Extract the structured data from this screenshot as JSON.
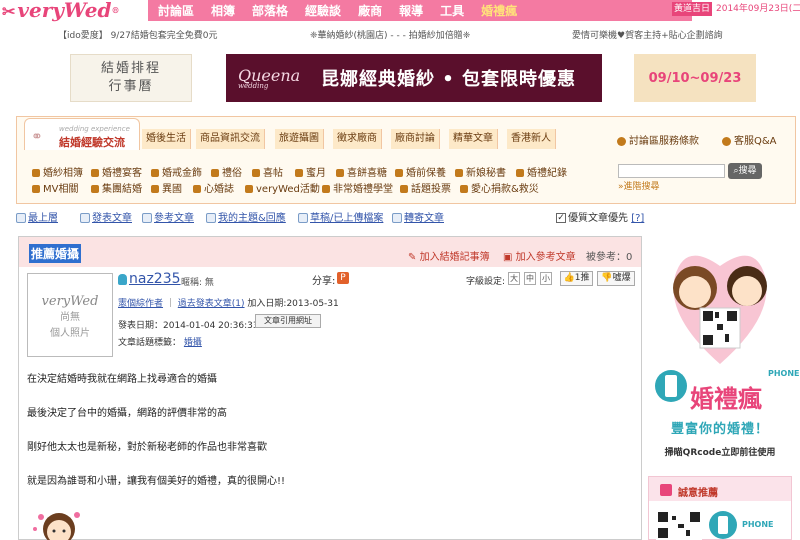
{
  "header": {
    "logo": "veryWed",
    "nav": [
      "討論區",
      "相簿",
      "部落格",
      "經驗談",
      "廠商",
      "報導",
      "工具",
      "婚禮瘋"
    ],
    "luck_badge": "黃道吉日",
    "date": "2014年09月23日(二)"
  },
  "ticker": [
    "【ido愛度】 9/27結婚包套完全免費0元",
    "❈華納婚紗(桃園店) - - - 拍婚紗加倍贈❈",
    "愛情可樂機♥賀客主持+貼心企劃諮詢"
  ],
  "banners": {
    "left": [
      "結婚排程",
      "行事曆"
    ],
    "center_brand": "Queena",
    "center_brand_sub": "wedding",
    "center_slogan": "昆娜經典婚紗 • 包套限時優惠",
    "right": "09/10~09/23"
  },
  "section": {
    "title_small": "wedding experience",
    "title": "結婚經驗交流",
    "tabs": [
      "婚後生活",
      "商品資訊交流",
      "旅遊攝圖",
      "徵求廠商",
      "廠商討論",
      "精華文章",
      "香港新人"
    ],
    "rules": "討論區服務條款",
    "faq": "客服Q&A",
    "sub_row1": [
      "婚紗相簿",
      "婚禮宴客",
      "婚戒金飾",
      "禮俗",
      "喜帖",
      "蜜月",
      "喜餅喜糖",
      "婚前保養",
      "新娘秘書",
      "婚禮紀錄"
    ],
    "sub_row2": [
      "MV相關",
      "集團結婚",
      "異國",
      "心婚誌",
      "veryWed活動",
      "非常婚禮學堂",
      "話題投票",
      "愛心捐款&救災"
    ],
    "search_button": "搜尋",
    "advanced_search": "»進階搜尋"
  },
  "toolbar": {
    "links": [
      "最上層",
      "發表文章",
      "參考文章",
      "我的主題&回應",
      "草稿/已上傳檔案",
      "轉寄文章"
    ],
    "priority_label": "優質文章優先",
    "priority_help": "[?]"
  },
  "post": {
    "title": "推薦婚攝",
    "add_note": "加入結婚記事簿",
    "add_ref": "加入參考文章",
    "ref_count": "被參考：0",
    "avatar_brand": "veryWed",
    "avatar_text": [
      "尚無",
      "個人照片"
    ],
    "username": "naz235",
    "nickname": "暱稱: 無",
    "share_label": "分享:",
    "share_icon": "P",
    "font_label": "字級設定:",
    "font_sizes": [
      "大",
      "中",
      "小"
    ],
    "like": "1推",
    "dislike": "噓爆",
    "user_link1": "憲個綜作者",
    "user_link2": "過去發表文章(1)",
    "join_date": "加入日期:2013-05-31",
    "publish_date": "發表日期：2014-01-04 20:36:33",
    "copy_url": "文章引用網址",
    "tag_label": "文章話題標籤：",
    "tag": "婚攝",
    "body": [
      "在決定結婚時我就在網路上找尋適合的婚攝",
      "最後決定了台中的婚攝，網路的評價非常的高",
      "剛好他太太也是新秘，對於新秘老師的作品也非常喜歡",
      "就是因為誰哥和小珊，讓我有個美好的婚禮，真的很開心!!"
    ]
  },
  "ad": {
    "phone_label": "PHONE",
    "brand": "婚禮瘋",
    "tagline": "豐富你的婚禮！",
    "scan": "掃瞄QRcode立即前往使用",
    "recommend": "誠意推薦",
    "rec_phone_label": "PHONE"
  },
  "colors": {
    "pink": "#e8457a",
    "nav": "#f47aa2",
    "brown": "#6a3c10",
    "blue": "#3355aa",
    "teal": "#2fa7b7"
  }
}
